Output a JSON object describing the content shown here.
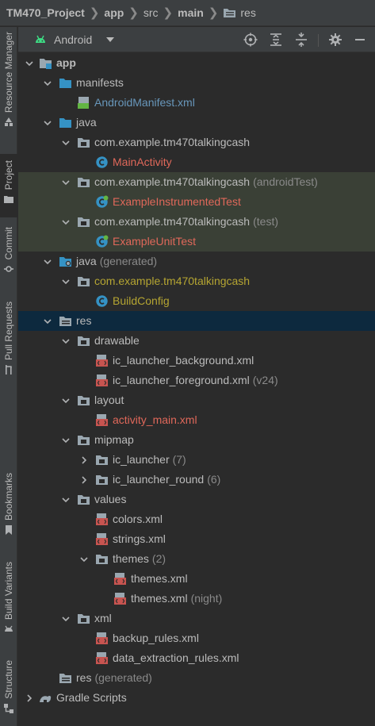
{
  "breadcrumb": {
    "project": "TM470_Project",
    "module": "app",
    "src": "src",
    "source_set": "main",
    "folder": "res"
  },
  "left_stripe": {
    "resource_manager": "Resource Manager",
    "project": "Project",
    "commit": "Commit",
    "pull_requests": "Pull Requests",
    "bookmarks": "Bookmarks",
    "build_variants": "Build Variants",
    "structure": "Structure"
  },
  "toolbar": {
    "view_mode": "Android"
  },
  "colors": {
    "background": "#2b2b2b",
    "panel": "#3c3f41",
    "selection": "#0d293e",
    "test_highlight": "#3a4036",
    "text": "#bbbbbb",
    "hint": "#8a8a8a",
    "error_red": "#e0685a",
    "generated_olive": "#b5a532",
    "link_blue": "#6897bb"
  },
  "tree": [
    {
      "label": "app",
      "hint": "",
      "icon": "module-folder-icon",
      "expanded": true
    },
    {
      "label": "manifests",
      "hint": "",
      "icon": "folder-icon",
      "expanded": true
    },
    {
      "label": "AndroidManifest.xml",
      "hint": "",
      "icon": "manifest-file-icon"
    },
    {
      "label": "java",
      "hint": "",
      "icon": "folder-icon",
      "expanded": true
    },
    {
      "label": "com.example.tm470talkingcash",
      "hint": "",
      "icon": "package-icon",
      "expanded": true
    },
    {
      "label": "MainActivity",
      "hint": "",
      "icon": "class-icon"
    },
    {
      "label": "com.example.tm470talkingcash",
      "hint": "(androidTest)",
      "icon": "package-icon",
      "expanded": true
    },
    {
      "label": "ExampleInstrumentedTest",
      "hint": "",
      "icon": "test-class-icon"
    },
    {
      "label": "com.example.tm470talkingcash",
      "hint": "(test)",
      "icon": "package-icon",
      "expanded": true
    },
    {
      "label": "ExampleUnitTest",
      "hint": "",
      "icon": "test-class-icon"
    },
    {
      "label": "java",
      "hint": "(generated)",
      "icon": "generated-folder-icon",
      "expanded": true
    },
    {
      "label": "com.example.tm470talkingcash",
      "hint": "",
      "icon": "package-icon",
      "expanded": true
    },
    {
      "label": "BuildConfig",
      "hint": "",
      "icon": "class-icon"
    },
    {
      "label": "res",
      "hint": "",
      "icon": "res-folder-icon",
      "expanded": true
    },
    {
      "label": "drawable",
      "hint": "",
      "icon": "package-icon",
      "expanded": true
    },
    {
      "label": "ic_launcher_background.xml",
      "hint": "",
      "icon": "xml-file-icon"
    },
    {
      "label": "ic_launcher_foreground.xml",
      "hint": "(v24)",
      "icon": "xml-file-icon"
    },
    {
      "label": "layout",
      "hint": "",
      "icon": "package-icon",
      "expanded": true
    },
    {
      "label": "activity_main.xml",
      "hint": "",
      "icon": "xml-file-icon"
    },
    {
      "label": "mipmap",
      "hint": "",
      "icon": "package-icon",
      "expanded": true
    },
    {
      "label": "ic_launcher",
      "hint": "(7)",
      "icon": "package-icon",
      "expanded": false
    },
    {
      "label": "ic_launcher_round",
      "hint": "(6)",
      "icon": "package-icon",
      "expanded": false
    },
    {
      "label": "values",
      "hint": "",
      "icon": "package-icon",
      "expanded": true
    },
    {
      "label": "colors.xml",
      "hint": "",
      "icon": "xml-file-icon"
    },
    {
      "label": "strings.xml",
      "hint": "",
      "icon": "xml-file-icon"
    },
    {
      "label": "themes",
      "hint": "(2)",
      "icon": "package-icon",
      "expanded": true
    },
    {
      "label": "themes.xml",
      "hint": "",
      "icon": "xml-file-icon"
    },
    {
      "label": "themes.xml",
      "hint": "(night)",
      "icon": "xml-file-icon"
    },
    {
      "label": "xml",
      "hint": "",
      "icon": "package-icon",
      "expanded": true
    },
    {
      "label": "backup_rules.xml",
      "hint": "",
      "icon": "xml-file-icon"
    },
    {
      "label": "data_extraction_rules.xml",
      "hint": "",
      "icon": "xml-file-icon"
    },
    {
      "label": "res",
      "hint": "(generated)",
      "icon": "res-folder-icon"
    },
    {
      "label": "Gradle Scripts",
      "hint": "",
      "icon": "gradle-icon",
      "expanded": false
    }
  ]
}
